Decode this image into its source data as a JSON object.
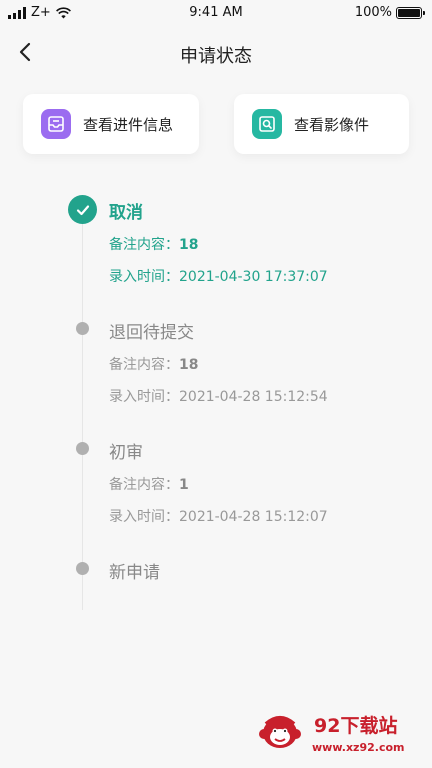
{
  "status_bar": {
    "carrier": "Z+",
    "time": "9:41 AM",
    "battery": "100%"
  },
  "nav": {
    "title": "申请状态"
  },
  "actions": [
    {
      "label": "查看进件信息",
      "icon": "mail-tray-icon",
      "color": "#9b6cf0"
    },
    {
      "label": "查看影像件",
      "icon": "image-search-icon",
      "color": "#26b8a2"
    }
  ],
  "colors": {
    "accent": "#22a38c",
    "inactive_dot": "#b0b0b0"
  },
  "timeline": [
    {
      "status": "取消",
      "active": true,
      "remark_label": "备注内容：",
      "remark_value": "18",
      "time_label": "录入时间：",
      "time_value": "2021-04-30 17:37:07"
    },
    {
      "status": "退回待提交",
      "active": false,
      "remark_label": "备注内容：",
      "remark_value": "18",
      "time_label": "录入时间：",
      "time_value": "2021-04-28 15:12:54"
    },
    {
      "status": "初审",
      "active": false,
      "remark_label": "备注内容：",
      "remark_value": "1",
      "time_label": "录入时间：",
      "time_value": "2021-04-28 15:12:07"
    },
    {
      "status": "新申请",
      "active": false
    }
  ],
  "watermark": {
    "title": "92下载站",
    "url": "www.xz92.com"
  }
}
